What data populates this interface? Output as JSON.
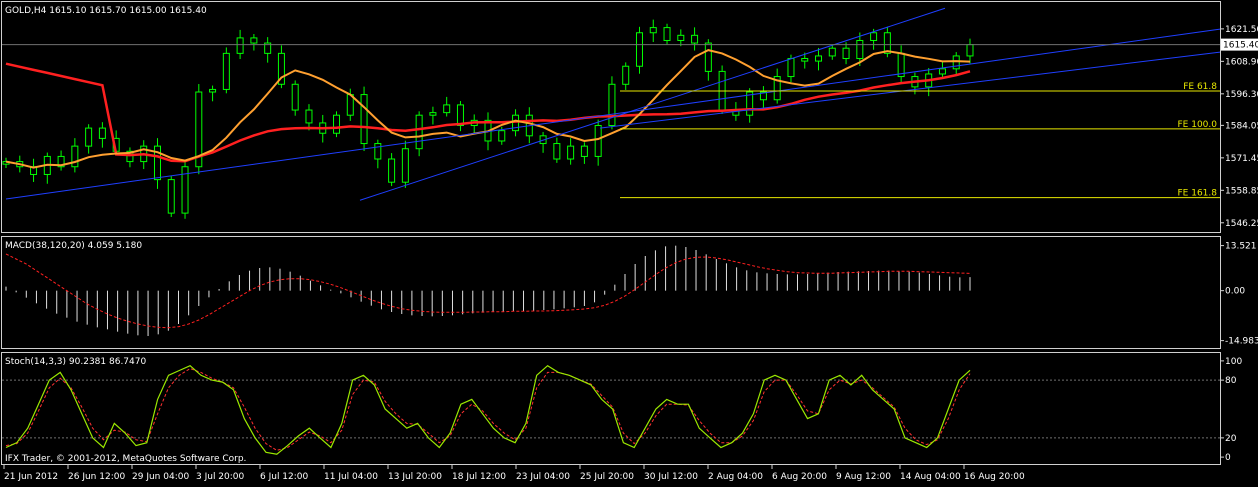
{
  "terminal": {
    "footer_text": "IFX Trader, © 2001-2012, MetaQuotes Software Corp."
  },
  "colors": {
    "background": "#000000",
    "frame": "#d0d0d0",
    "candles": "#00ff00",
    "ma_slow": "#ff2020",
    "ma_fast": "#ffa030",
    "channel": "#1f3fff",
    "fibo": "#e8e800",
    "price_line": "#707070",
    "macd_hist": "#e0e0e0",
    "macd_signal": "#ff2020",
    "stoch_main": "#9be800",
    "stoch_signal": "#ff3030",
    "stoch_levels": "#707070"
  },
  "chart_data": [
    {
      "type": "candlestick",
      "title": "GOLD,H4  1615.10 1615.70 1615.00 1615.40",
      "current_price_label": "1615.40",
      "y_tick_labels": [
        "1621.50",
        "1608.90",
        "1596.30",
        "1584.05",
        "1571.45",
        "1558.85",
        "1546.25"
      ],
      "y_ticks": [
        1621.5,
        1608.9,
        1596.3,
        1584.05,
        1571.45,
        1558.85,
        1546.25
      ],
      "ylim": [
        1545.0,
        1626.5
      ],
      "time_labels": [
        "21 Jun 2012",
        "26 Jun 12:00",
        "29 Jun 04:00",
        "3 Jul 20:00",
        "6 Jul 12:00",
        "11 Jul 04:00",
        "13 Jul 20:00",
        "18 Jul 12:00",
        "23 Jul 04:00",
        "25 Jul 20:00",
        "30 Jul 12:00",
        "2 Aug 04:00",
        "6 Aug 20:00",
        "9 Aug 12:00",
        "14 Aug 04:00",
        "16 Aug 20:00"
      ],
      "close": [
        1570,
        1568,
        1565,
        1572,
        1568,
        1576,
        1583,
        1579,
        1574,
        1570,
        1576,
        1563,
        1550,
        1568,
        1597,
        1598,
        1612,
        1618,
        1616,
        1612,
        1600,
        1590,
        1585,
        1581,
        1588,
        1596,
        1577,
        1571,
        1562,
        1575,
        1588,
        1589,
        1592,
        1584,
        1586,
        1578,
        1582,
        1588,
        1580,
        1577,
        1571,
        1576,
        1572,
        1584,
        1600,
        1607,
        1620,
        1622,
        1617,
        1619,
        1616,
        1605,
        1590,
        1588,
        1597,
        1594,
        1603,
        1610,
        1609,
        1611,
        1614,
        1610,
        1617,
        1620,
        1612,
        1603,
        1599,
        1604,
        1606,
        1611,
        1615.4
      ],
      "ma_slow_end": 1602,
      "fibo_levels": [
        {
          "label": "FE 61.8",
          "value": 1597.4
        },
        {
          "label": "FE 100.0",
          "value": 1582.7
        },
        {
          "label": "FE 161.8",
          "value": 1556.0
        }
      ]
    },
    {
      "type": "histogram",
      "title": "MACD(38,120,20) 4.059 5.180",
      "y_tick_labels": [
        "13.521",
        "0.00",
        "-14.983"
      ],
      "ylim": [
        -16.0,
        14.6
      ],
      "hist_values": [
        1.2,
        -0.5,
        -2.1,
        -3.8,
        -5.4,
        -6.9,
        -8.1,
        -9.3,
        -10.2,
        -11.0,
        -11.6,
        -12.3,
        -12.9,
        -13.4,
        -13.6,
        -13.1,
        -12.0,
        -10.0,
        -7.4,
        -4.6,
        -2.0,
        0.5,
        2.8,
        4.7,
        6.0,
        6.8,
        7.0,
        6.6,
        5.7,
        4.5,
        3.0,
        1.6,
        0.3,
        -0.8,
        -2.0,
        -3.3,
        -4.5,
        -5.6,
        -6.4,
        -7.0,
        -7.4,
        -7.6,
        -7.7,
        -7.6,
        -7.4,
        -7.1,
        -6.8,
        -6.6,
        -6.4,
        -6.3,
        -6.2,
        -6.1,
        -6.0,
        -5.8,
        -5.6,
        -5.3,
        -5.0,
        -4.6,
        -3.5,
        -1.2,
        1.8,
        5.0,
        8.0,
        10.4,
        12.1,
        13.3,
        13.5,
        13.1,
        12.2,
        10.9,
        9.5,
        8.2,
        7.0,
        6.1,
        5.5,
        5.2,
        5.0,
        4.9,
        4.9,
        5.0,
        5.2,
        5.4,
        5.6,
        5.7,
        5.8,
        5.9,
        6.0,
        6.0,
        5.9,
        5.7,
        5.4,
        5.0,
        4.6,
        4.2,
        4.0,
        4.06
      ],
      "signal_values": [
        11.0,
        9.5,
        8.0,
        6.0,
        4.0,
        2.0,
        0.0,
        -2.0,
        -4.0,
        -5.6,
        -7.0,
        -8.2,
        -9.2,
        -10.0,
        -10.6,
        -11.0,
        -11.1,
        -10.8,
        -10.0,
        -8.8,
        -7.2,
        -5.4,
        -3.6,
        -1.8,
        0.0,
        1.5,
        2.6,
        3.3,
        3.6,
        3.6,
        3.3,
        2.7,
        1.9,
        0.9,
        -0.3,
        -1.5,
        -2.7,
        -3.8,
        -4.7,
        -5.4,
        -5.9,
        -6.2,
        -6.4,
        -6.5,
        -6.5,
        -6.5,
        -6.4,
        -6.4,
        -6.3,
        -6.3,
        -6.2,
        -6.2,
        -6.1,
        -6.1,
        -6.0,
        -5.9,
        -5.7,
        -5.5,
        -5.1,
        -4.4,
        -3.2,
        -1.6,
        0.4,
        2.6,
        4.8,
        6.8,
        8.4,
        9.5,
        10.0,
        10.1,
        9.8,
        9.3,
        8.6,
        7.9,
        7.2,
        6.6,
        6.1,
        5.7,
        5.4,
        5.3,
        5.2,
        5.2,
        5.3,
        5.4,
        5.5,
        5.6,
        5.7,
        5.8,
        5.8,
        5.8,
        5.7,
        5.6,
        5.5,
        5.4,
        5.3,
        5.18
      ]
    },
    {
      "type": "line",
      "title": "Stoch(14,3,3) 90.2381 86.7470",
      "y_tick_labels": [
        "100",
        "80",
        "20",
        "0"
      ],
      "ylim": [
        -3,
        103
      ],
      "main_values": [
        10,
        15,
        30,
        55,
        80,
        88,
        70,
        45,
        20,
        10,
        35,
        25,
        12,
        15,
        60,
        85,
        90,
        95,
        85,
        80,
        78,
        70,
        40,
        20,
        5,
        3,
        12,
        22,
        30,
        20,
        10,
        35,
        80,
        85,
        75,
        50,
        40,
        30,
        35,
        20,
        10,
        25,
        55,
        60,
        45,
        30,
        20,
        15,
        35,
        85,
        95,
        88,
        85,
        80,
        75,
        60,
        50,
        15,
        10,
        30,
        50,
        60,
        55,
        55,
        30,
        20,
        10,
        15,
        25,
        45,
        80,
        85,
        80,
        60,
        40,
        45,
        80,
        85,
        75,
        85,
        70,
        60,
        50,
        20,
        15,
        10,
        20,
        50,
        80,
        90.24
      ],
      "signal_values": [
        12,
        14,
        25,
        48,
        72,
        82,
        72,
        52,
        30,
        18,
        28,
        26,
        18,
        16,
        45,
        72,
        85,
        92,
        88,
        82,
        78,
        72,
        52,
        30,
        14,
        7,
        10,
        18,
        26,
        22,
        15,
        28,
        65,
        80,
        78,
        58,
        45,
        35,
        34,
        25,
        15,
        22,
        45,
        55,
        48,
        35,
        25,
        18,
        30,
        72,
        88,
        88,
        85,
        80,
        76,
        64,
        52,
        25,
        14,
        25,
        43,
        55,
        55,
        54,
        38,
        25,
        15,
        15,
        22,
        38,
        68,
        80,
        80,
        65,
        48,
        45,
        70,
        80,
        76,
        80,
        72,
        62,
        52,
        30,
        18,
        13,
        18,
        40,
        70,
        86.75
      ],
      "levels": [
        80,
        20
      ]
    }
  ]
}
